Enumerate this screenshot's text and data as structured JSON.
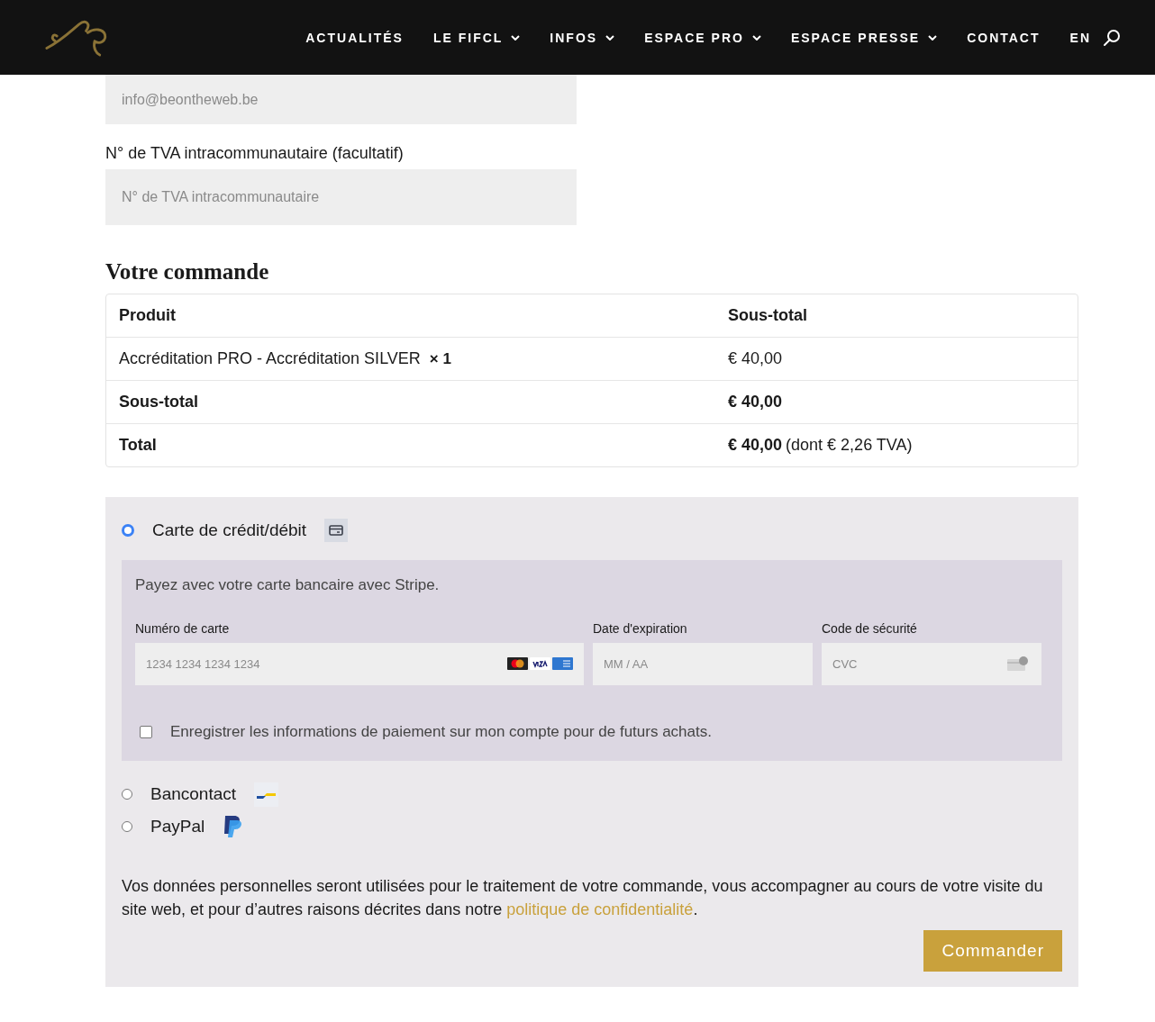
{
  "nav": {
    "items": [
      {
        "label": "ACTUALITÉS",
        "dropdown": false
      },
      {
        "label": "LE FIFCL",
        "dropdown": true
      },
      {
        "label": "INFOS",
        "dropdown": true
      },
      {
        "label": "ESPACE PRO",
        "dropdown": true
      },
      {
        "label": "ESPACE PRESSE",
        "dropdown": true
      },
      {
        "label": "CONTACT",
        "dropdown": false
      },
      {
        "label": "EN",
        "dropdown": false
      }
    ]
  },
  "email_field": {
    "placeholder": "info@beontheweb.be"
  },
  "vat_field": {
    "label": "N° de TVA intracommunautaire (facultatif)",
    "placeholder": "N° de TVA intracommunautaire"
  },
  "order": {
    "title": "Votre commande",
    "columns": [
      "Produit",
      "Sous-total"
    ],
    "rows": [
      {
        "kind": "item",
        "label": "Accréditation PRO - Accréditation SILVER",
        "quantity": "× 1",
        "value": "€ 40,00"
      },
      {
        "kind": "subtotal",
        "label": "Sous-total",
        "value": "€ 40,00"
      },
      {
        "kind": "total",
        "label": "Total",
        "value": "€ 40,00",
        "note": "(dont € 2,26 TVA)"
      }
    ]
  },
  "payment": {
    "methods": [
      {
        "kind": "card",
        "label": "Carte de crédit/débit",
        "selected": true
      },
      {
        "kind": "bancontact",
        "label": "Bancontact",
        "selected": false
      },
      {
        "kind": "paypal",
        "label": "PayPal",
        "selected": false
      }
    ],
    "card_box": {
      "intro": "Payez avec votre carte bancaire avec Stripe.",
      "fields": [
        {
          "kind": "number",
          "label": "Numéro de carte",
          "placeholder": "1234 1234 1234 1234"
        },
        {
          "kind": "expiry",
          "label": "Date d'expiration",
          "placeholder": "MM / AA"
        },
        {
          "kind": "cvc",
          "label": "Code de sécurité",
          "placeholder": "CVC"
        }
      ],
      "save": {
        "label": "Enregistrer les informations de paiement sur mon compte pour de futurs achats.",
        "checked": false
      }
    },
    "privacy": {
      "before": "Vos données personnelles seront utilisées pour le traitement de votre commande, vous accompagner au cours de votre visite du site web, et pour d’autres raisons décrites dans notre ",
      "link": "politique de confidentialité",
      "after": "."
    },
    "submit": "Commander"
  }
}
